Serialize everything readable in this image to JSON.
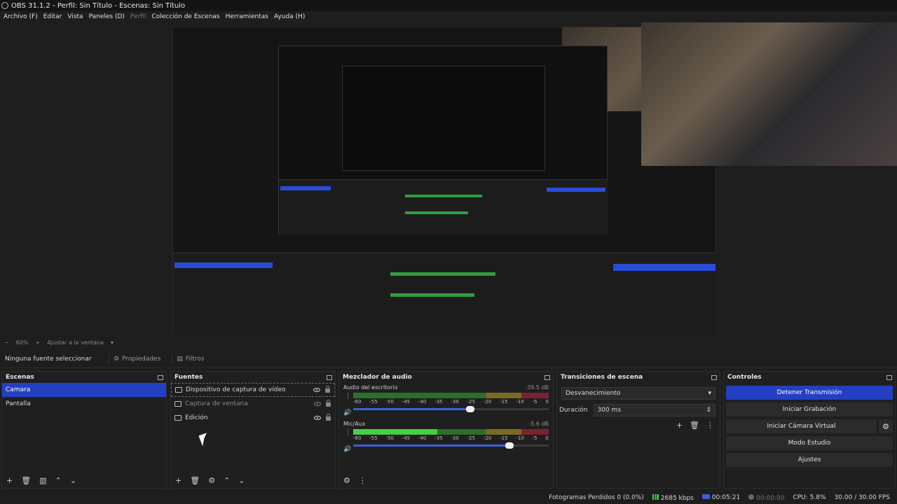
{
  "window": {
    "title": "OBS 31.1.2 - Perfil: Sin Título - Escenas: Sin Título"
  },
  "menu": [
    {
      "label": "Archivo (F)",
      "dim": false
    },
    {
      "label": "Editar",
      "dim": false
    },
    {
      "label": "Vista",
      "dim": false
    },
    {
      "label": "Paneles (D)",
      "dim": false
    },
    {
      "label": "Perfil",
      "dim": true
    },
    {
      "label": "Colección de Escenas",
      "dim": false
    },
    {
      "label": "Herramientas",
      "dim": false
    },
    {
      "label": "Ayuda (H)",
      "dim": false
    }
  ],
  "zoom": {
    "level": "60%",
    "plus": "+",
    "fit_label": "Ajustar a la ventana"
  },
  "context": {
    "no_source": "Ninguna fuente seleccionar",
    "properties": "Propiedades",
    "filters": "Filtros"
  },
  "scenes": {
    "title": "Escenas",
    "items": [
      {
        "label": "Camara",
        "selected": true
      },
      {
        "label": "Pantalla",
        "selected": false
      }
    ]
  },
  "sources": {
    "title": "Fuentes",
    "items": [
      {
        "label": "Dispositivo de captura de vídeo",
        "icon": "camera-icon",
        "visible": true
      },
      {
        "label": "Captura de ventana",
        "icon": "window-icon",
        "visible": false
      },
      {
        "label": "Edición",
        "icon": "display-icon",
        "visible": true
      }
    ]
  },
  "mixer": {
    "title": "Mezclador de audio",
    "ticks": [
      "-60",
      "-55",
      "-50",
      "-45",
      "-40",
      "-35",
      "-30",
      "-25",
      "-20",
      "-15",
      "-10",
      "-5",
      "0"
    ],
    "channels": [
      {
        "name": "Audio del escritorio",
        "db": "-39.5 dB",
        "level": 0.0,
        "volume": 0.6
      },
      {
        "name": "Mic/Aux",
        "db": "-5.6 dB",
        "level": 0.43,
        "volume": 0.8
      }
    ]
  },
  "transitions": {
    "title": "Transiciones de escena",
    "selected": "Desvanecimiento",
    "duration_label": "Duración",
    "duration_value": "300 ms"
  },
  "controls": {
    "title": "Controles",
    "stop_stream": "Detener Transmisión",
    "start_record": "Iniciar Grabación",
    "start_vcam": "Iniciar Cámara Virtual",
    "studio_mode": "Modo Estudio",
    "settings": "Ajustes"
  },
  "status": {
    "dropped": "Fotogramas Perdidos 0 (0.0%)",
    "bitrate": "2685 kbps",
    "stream_time": "00:05:21",
    "rec_time": "00:00:00",
    "cpu": "CPU: 5.8%",
    "fps": "30.00 / 30.00 FPS"
  },
  "colors": {
    "accent": "#2440c2",
    "meter_green": "#43d243"
  }
}
